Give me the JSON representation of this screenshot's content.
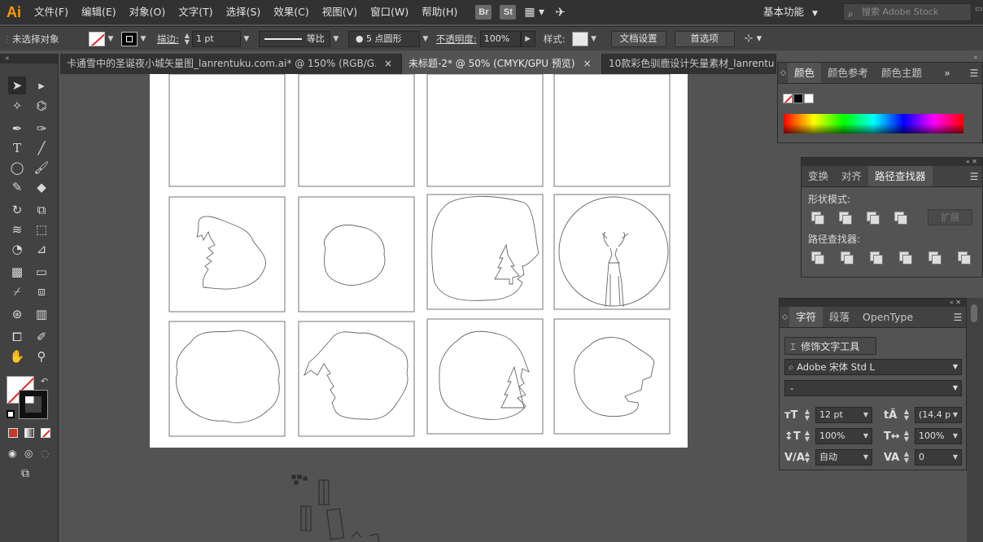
{
  "app": {
    "logo": "Ai"
  },
  "menu": [
    "文件(F)",
    "编辑(E)",
    "对象(O)",
    "文字(T)",
    "选择(S)",
    "效果(C)",
    "视图(V)",
    "窗口(W)",
    "帮助(H)"
  ],
  "menubar_icons": {
    "bridge": "Br",
    "stock": "St"
  },
  "workspace": {
    "label": "基本功能"
  },
  "stock_search": {
    "placeholder": "搜索 Adobe Stock"
  },
  "control": {
    "selection_status": "未选择对象",
    "stroke_label": "描边:",
    "stroke_value": "1 pt",
    "profile_label": "等比",
    "brush_label": "5 点圆形",
    "opacity_label": "不透明度:",
    "opacity_value": "100%",
    "style_label": "样式:",
    "doc_settings_button": "文档设置",
    "preferences_button": "首选项"
  },
  "tabs": [
    {
      "label": "卡通雪中的圣诞夜小城矢量图_lanrentuku.com.ai* @ 150% (RGB/G...",
      "active": false
    },
    {
      "label": "未标题-2* @ 50% (CMYK/GPU 预览)",
      "active": true
    },
    {
      "label": "10款彩色驯鹿设计矢量素材_lanrentu",
      "active": false
    }
  ],
  "color_panel": {
    "tabs": [
      "颜色",
      "颜色参考",
      "颜色主题"
    ]
  },
  "pathfinder_panel": {
    "tabs": [
      "变换",
      "对齐",
      "路径查找器"
    ],
    "shape_modes_label": "形状模式:",
    "expand_button": "扩展",
    "pathfinders_label": "路径查找器:"
  },
  "character_panel": {
    "tabs": [
      "字符",
      "段落",
      "OpenType"
    ],
    "touch_type_button": "修饰文字工具",
    "font_family": "Adobe 宋体 Std L",
    "font_style": "-",
    "font_size": "12 pt",
    "leading": "(14.4 p",
    "vertical_scale": "100%",
    "horizontal_scale": "100%",
    "kerning": "自动",
    "tracking": "0"
  }
}
